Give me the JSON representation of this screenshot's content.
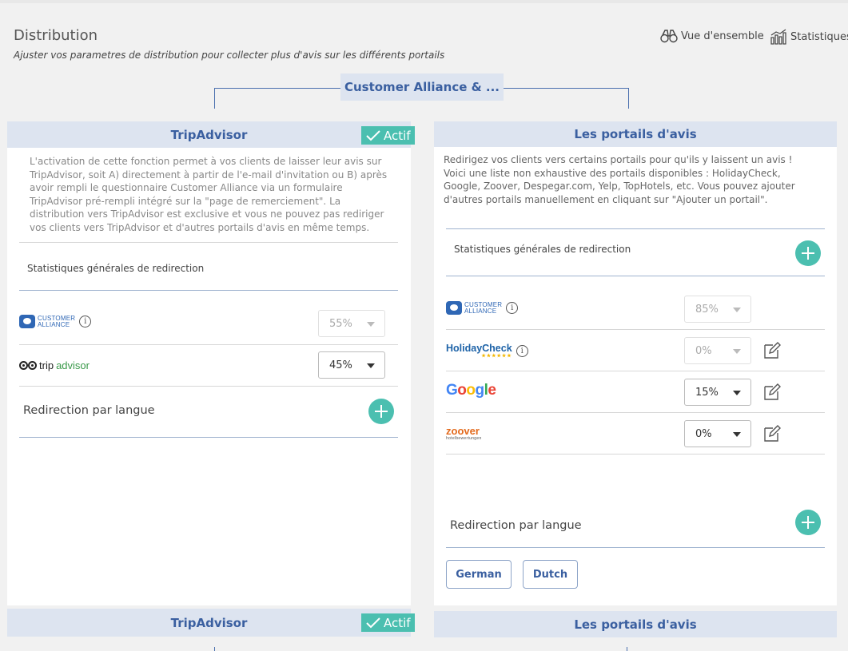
{
  "header": {
    "title": "Distribution",
    "subtitle": "Ajuster vos parametres de distribution pour collecter plus d'avis sur les différents portails",
    "links": {
      "overview": "Vue d'ensemble",
      "stats": "Statistiques"
    }
  },
  "tree": {
    "root_label": "Customer Alliance & ..."
  },
  "left_panel": {
    "title": "TripAdvisor",
    "badge": "Actif",
    "description": "L'activation de cette fonction permet à vos clients de laisser leur avis sur TripAdvisor, soit A) directement à partir de l'e-mail d'invitation ou B) après avoir rempli le questionnaire Customer Alliance via un formulaire TripAdvisor pré-rempli intégré sur la \"page de remerciement\". La distribution vers TripAdvisor est exclusive et vous ne pouvez pas rediriger vos clients vers TripAdvisor et d'autres portails d'avis en même temps.",
    "stats_label": "Statistiques générales de redirection",
    "portals": [
      {
        "logo_line1": "CUSTOMER",
        "logo_line2": "ALLIANCE",
        "percent": "55%",
        "disabled": true
      },
      {
        "logo_main": "trip",
        "logo_sub": "advisor",
        "percent": "45%",
        "disabled": false
      }
    ],
    "language_label": "Redirection par langue"
  },
  "right_panel": {
    "title": "Les portails d'avis",
    "description": "Redirigez vos clients vers certains portails pour qu'ils y laissent un avis ! Voici une liste non exhaustive des portails disponibles : HolidayCheck, Google, Zoover, Despegar.com, Yelp, TopHotels, etc. Vous pouvez ajouter d'autres portails manuellement en cliquant sur \"Ajouter un portail\".",
    "stats_label": "Statistiques générales de redirection",
    "portals": [
      {
        "logo_line1": "CUSTOMER",
        "logo_line2": "ALLIANCE",
        "percent": "85%",
        "disabled": true
      },
      {
        "logo": "HolidayCheck",
        "percent": "0%",
        "disabled": true
      },
      {
        "logo": "Google",
        "percent": "15%",
        "disabled": false
      },
      {
        "logo": "zoover",
        "logo_sub": "hotelbewertungen",
        "percent": "0%",
        "disabled": false
      }
    ],
    "language_label": "Redirection par langue",
    "languages": [
      "German",
      "Dutch"
    ]
  },
  "bottom_row": {
    "left_title": "TripAdvisor",
    "left_badge": "Actif",
    "right_title": "Les portails d'avis"
  },
  "colors": {
    "accent_teal": "#4bbfb0",
    "header_bg": "#dde4f0",
    "header_text": "#3a5fa0",
    "line": "#4a6fae"
  }
}
